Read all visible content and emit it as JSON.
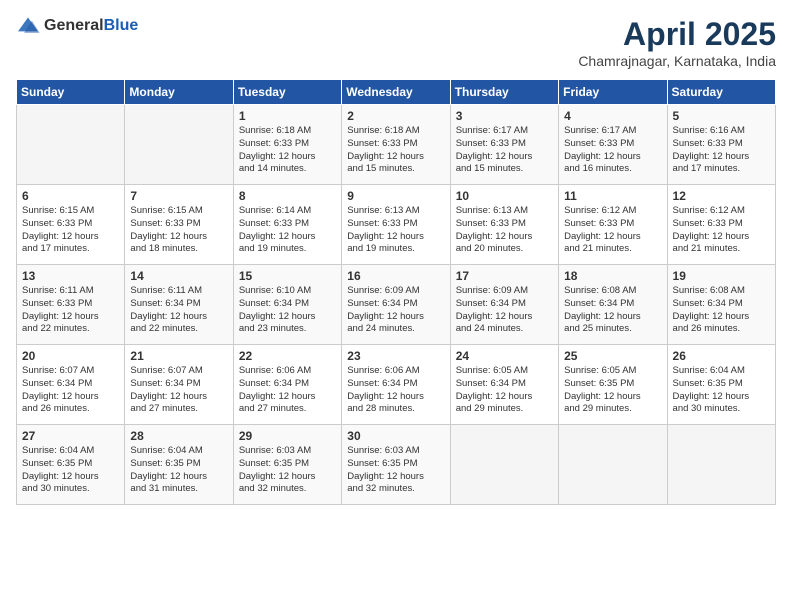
{
  "header": {
    "logo_general": "General",
    "logo_blue": "Blue",
    "title": "April 2025",
    "location": "Chamrajnagar, Karnataka, India"
  },
  "days_of_week": [
    "Sunday",
    "Monday",
    "Tuesday",
    "Wednesday",
    "Thursday",
    "Friday",
    "Saturday"
  ],
  "weeks": [
    [
      {
        "day": "",
        "info": ""
      },
      {
        "day": "",
        "info": ""
      },
      {
        "day": "1",
        "info": "Sunrise: 6:18 AM\nSunset: 6:33 PM\nDaylight: 12 hours\nand 14 minutes."
      },
      {
        "day": "2",
        "info": "Sunrise: 6:18 AM\nSunset: 6:33 PM\nDaylight: 12 hours\nand 15 minutes."
      },
      {
        "day": "3",
        "info": "Sunrise: 6:17 AM\nSunset: 6:33 PM\nDaylight: 12 hours\nand 15 minutes."
      },
      {
        "day": "4",
        "info": "Sunrise: 6:17 AM\nSunset: 6:33 PM\nDaylight: 12 hours\nand 16 minutes."
      },
      {
        "day": "5",
        "info": "Sunrise: 6:16 AM\nSunset: 6:33 PM\nDaylight: 12 hours\nand 17 minutes."
      }
    ],
    [
      {
        "day": "6",
        "info": "Sunrise: 6:15 AM\nSunset: 6:33 PM\nDaylight: 12 hours\nand 17 minutes."
      },
      {
        "day": "7",
        "info": "Sunrise: 6:15 AM\nSunset: 6:33 PM\nDaylight: 12 hours\nand 18 minutes."
      },
      {
        "day": "8",
        "info": "Sunrise: 6:14 AM\nSunset: 6:33 PM\nDaylight: 12 hours\nand 19 minutes."
      },
      {
        "day": "9",
        "info": "Sunrise: 6:13 AM\nSunset: 6:33 PM\nDaylight: 12 hours\nand 19 minutes."
      },
      {
        "day": "10",
        "info": "Sunrise: 6:13 AM\nSunset: 6:33 PM\nDaylight: 12 hours\nand 20 minutes."
      },
      {
        "day": "11",
        "info": "Sunrise: 6:12 AM\nSunset: 6:33 PM\nDaylight: 12 hours\nand 21 minutes."
      },
      {
        "day": "12",
        "info": "Sunrise: 6:12 AM\nSunset: 6:33 PM\nDaylight: 12 hours\nand 21 minutes."
      }
    ],
    [
      {
        "day": "13",
        "info": "Sunrise: 6:11 AM\nSunset: 6:33 PM\nDaylight: 12 hours\nand 22 minutes."
      },
      {
        "day": "14",
        "info": "Sunrise: 6:11 AM\nSunset: 6:34 PM\nDaylight: 12 hours\nand 22 minutes."
      },
      {
        "day": "15",
        "info": "Sunrise: 6:10 AM\nSunset: 6:34 PM\nDaylight: 12 hours\nand 23 minutes."
      },
      {
        "day": "16",
        "info": "Sunrise: 6:09 AM\nSunset: 6:34 PM\nDaylight: 12 hours\nand 24 minutes."
      },
      {
        "day": "17",
        "info": "Sunrise: 6:09 AM\nSunset: 6:34 PM\nDaylight: 12 hours\nand 24 minutes."
      },
      {
        "day": "18",
        "info": "Sunrise: 6:08 AM\nSunset: 6:34 PM\nDaylight: 12 hours\nand 25 minutes."
      },
      {
        "day": "19",
        "info": "Sunrise: 6:08 AM\nSunset: 6:34 PM\nDaylight: 12 hours\nand 26 minutes."
      }
    ],
    [
      {
        "day": "20",
        "info": "Sunrise: 6:07 AM\nSunset: 6:34 PM\nDaylight: 12 hours\nand 26 minutes."
      },
      {
        "day": "21",
        "info": "Sunrise: 6:07 AM\nSunset: 6:34 PM\nDaylight: 12 hours\nand 27 minutes."
      },
      {
        "day": "22",
        "info": "Sunrise: 6:06 AM\nSunset: 6:34 PM\nDaylight: 12 hours\nand 27 minutes."
      },
      {
        "day": "23",
        "info": "Sunrise: 6:06 AM\nSunset: 6:34 PM\nDaylight: 12 hours\nand 28 minutes."
      },
      {
        "day": "24",
        "info": "Sunrise: 6:05 AM\nSunset: 6:34 PM\nDaylight: 12 hours\nand 29 minutes."
      },
      {
        "day": "25",
        "info": "Sunrise: 6:05 AM\nSunset: 6:35 PM\nDaylight: 12 hours\nand 29 minutes."
      },
      {
        "day": "26",
        "info": "Sunrise: 6:04 AM\nSunset: 6:35 PM\nDaylight: 12 hours\nand 30 minutes."
      }
    ],
    [
      {
        "day": "27",
        "info": "Sunrise: 6:04 AM\nSunset: 6:35 PM\nDaylight: 12 hours\nand 30 minutes."
      },
      {
        "day": "28",
        "info": "Sunrise: 6:04 AM\nSunset: 6:35 PM\nDaylight: 12 hours\nand 31 minutes."
      },
      {
        "day": "29",
        "info": "Sunrise: 6:03 AM\nSunset: 6:35 PM\nDaylight: 12 hours\nand 32 minutes."
      },
      {
        "day": "30",
        "info": "Sunrise: 6:03 AM\nSunset: 6:35 PM\nDaylight: 12 hours\nand 32 minutes."
      },
      {
        "day": "",
        "info": ""
      },
      {
        "day": "",
        "info": ""
      },
      {
        "day": "",
        "info": ""
      }
    ]
  ]
}
